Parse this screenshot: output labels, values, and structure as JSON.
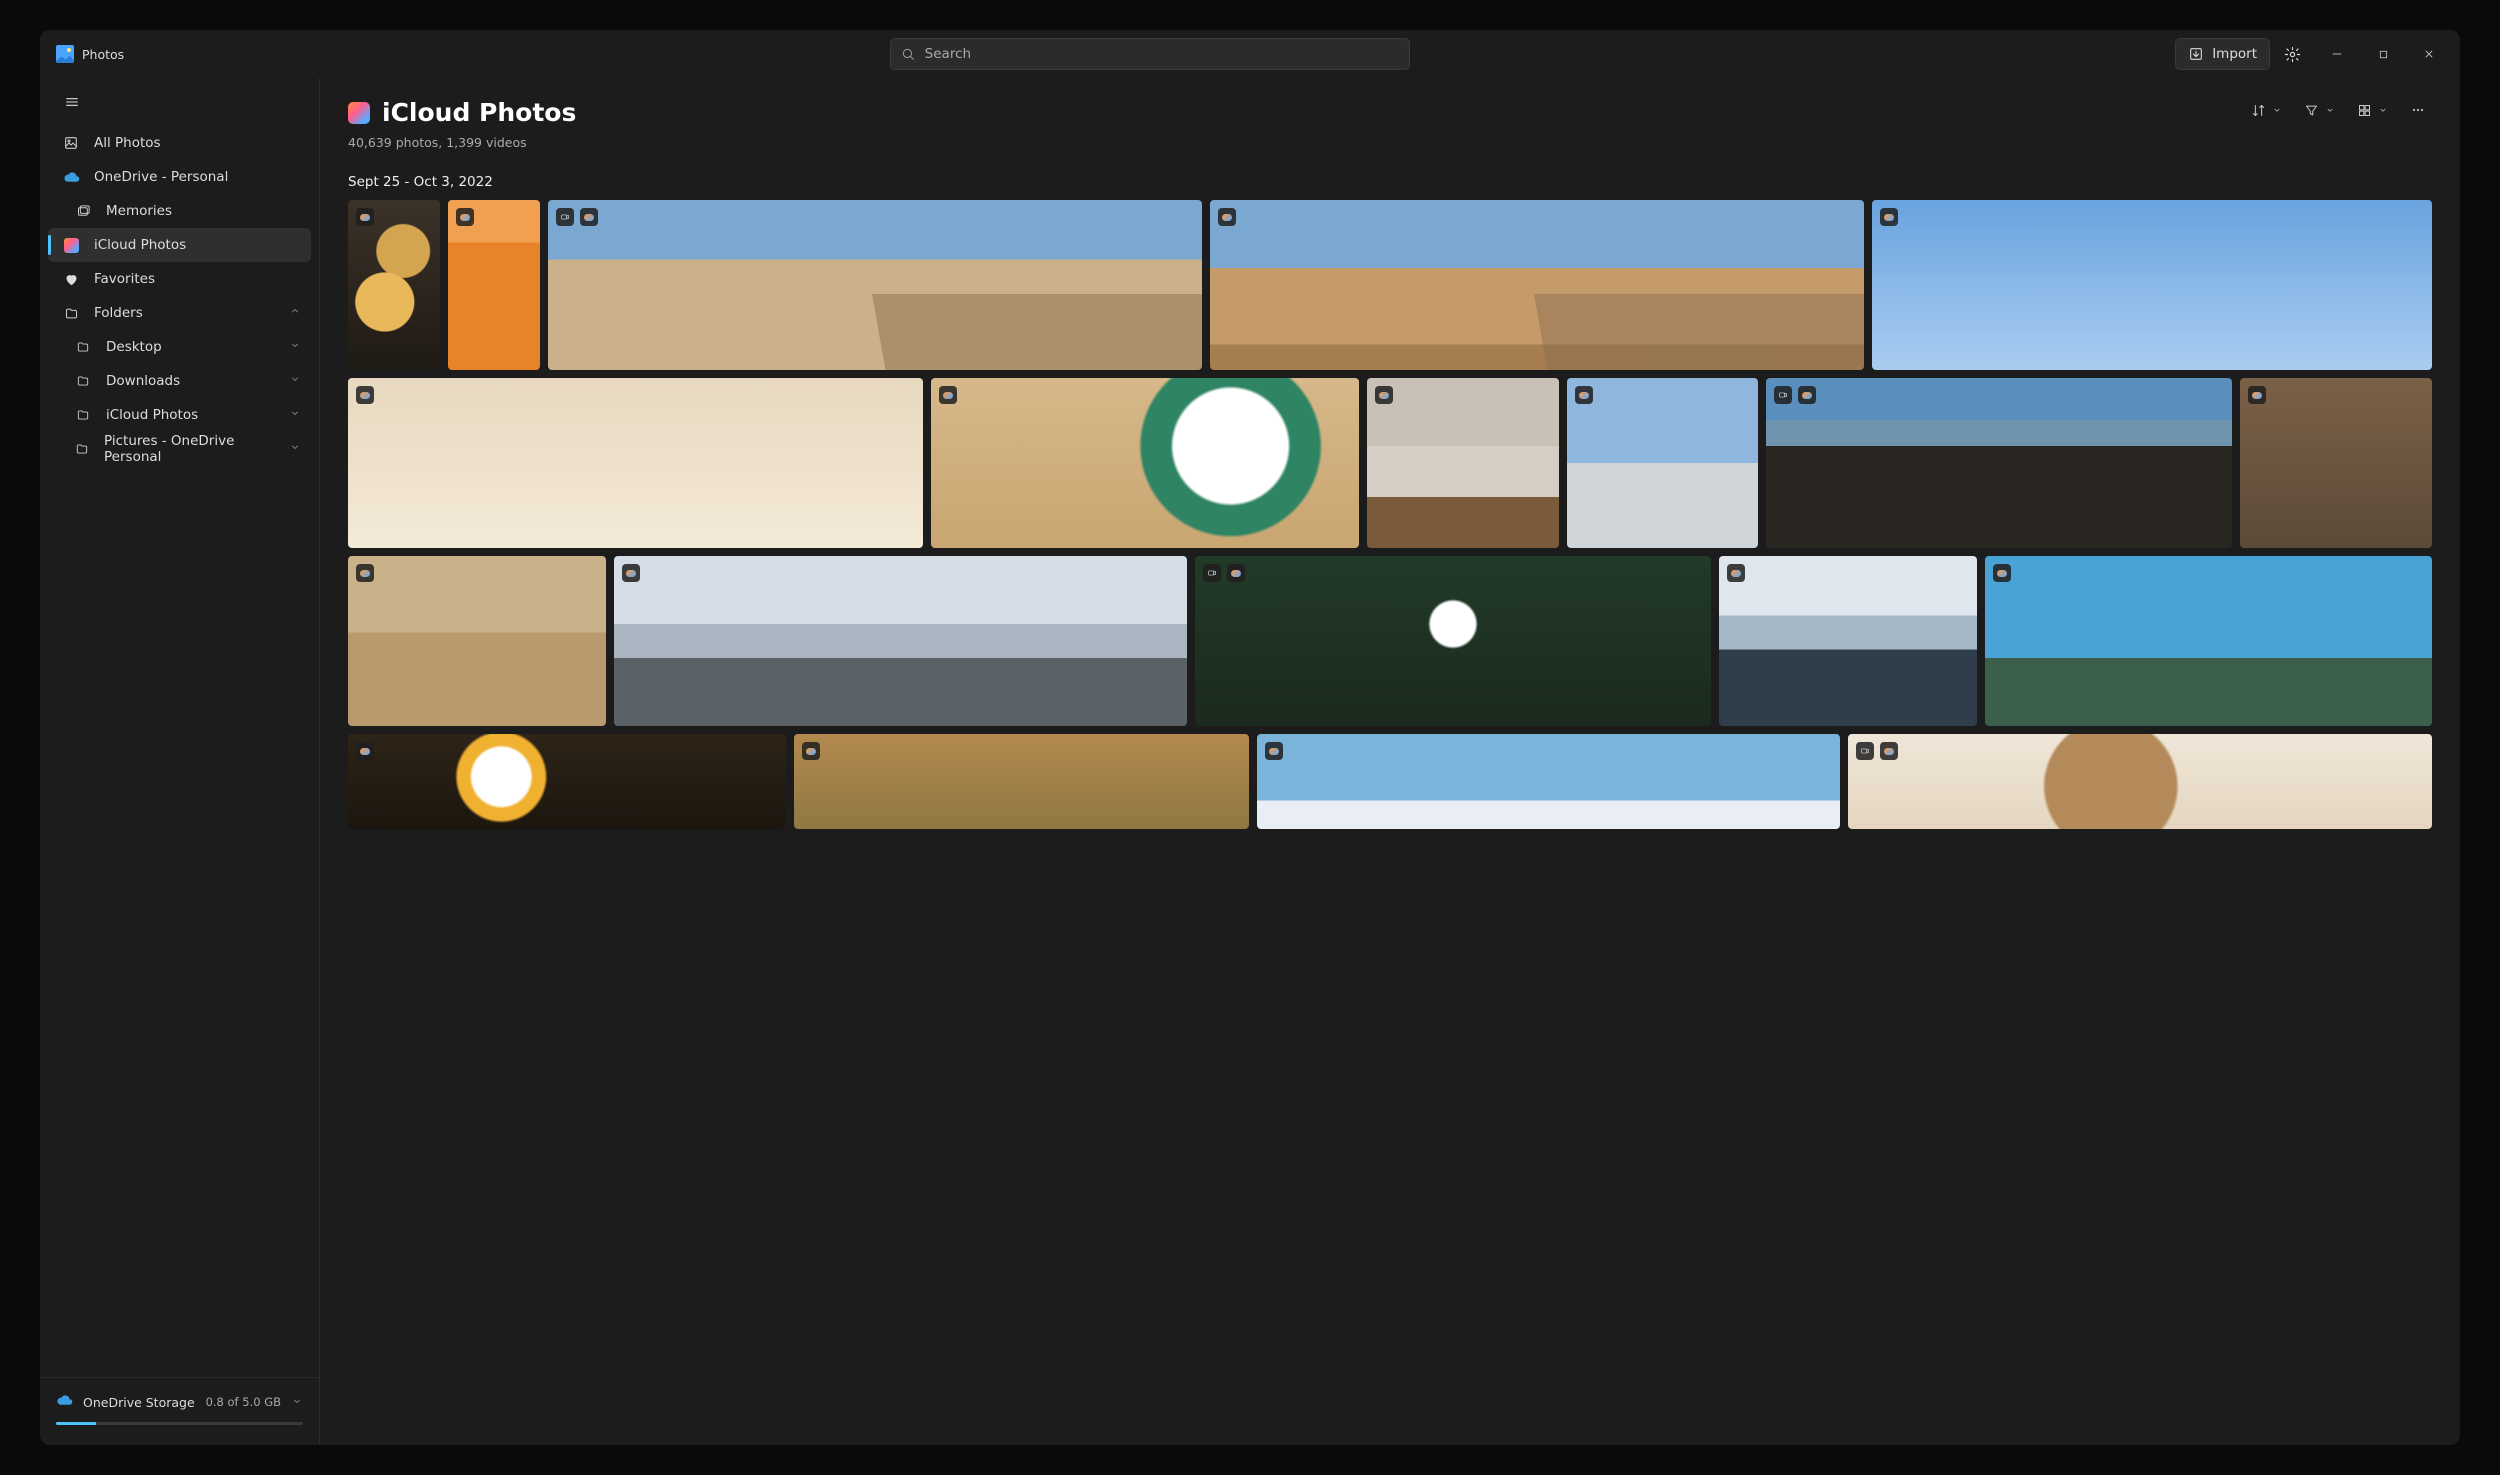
{
  "app": {
    "title": "Photos"
  },
  "search": {
    "placeholder": "Search"
  },
  "titlebar": {
    "import_label": "Import"
  },
  "sidebar": {
    "all_photos": "All Photos",
    "onedrive": "OneDrive - Personal",
    "memories": "Memories",
    "icloud": "iCloud Photos",
    "favorites": "Favorites",
    "folders": "Folders",
    "folder_items": {
      "desktop": "Desktop",
      "downloads": "Downloads",
      "icloud_photos": "iCloud Photos",
      "pictures_od": "Pictures - OneDrive Personal"
    }
  },
  "storage": {
    "label": "OneDrive Storage",
    "usage": "0.8 of 5.0 GB",
    "percent": 16
  },
  "main": {
    "title": "iCloud Photos",
    "subtitle": "40,639 photos, 1,399 videos",
    "date_header": "Sept 25 - Oct 3, 2022"
  }
}
